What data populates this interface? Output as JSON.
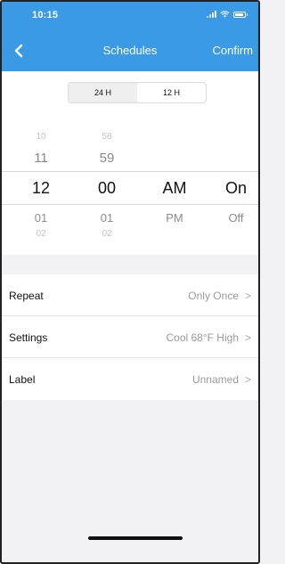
{
  "status_bar": {
    "time": "10:15"
  },
  "nav": {
    "title": "Schedules",
    "confirm_label": "Confirm"
  },
  "segmented": {
    "options": [
      "24 H",
      "12 H"
    ],
    "selected": "12 H"
  },
  "picker": {
    "hour": {
      "items": [
        "10",
        "11",
        "12",
        "01",
        "02"
      ]
    },
    "minute": {
      "items": [
        "58",
        "59",
        "00",
        "01",
        "02"
      ]
    },
    "period": {
      "items": [
        "",
        "",
        "AM",
        "PM",
        ""
      ]
    },
    "power": {
      "items": [
        "",
        "",
        "On",
        "Off",
        ""
      ]
    }
  },
  "settings_list": [
    {
      "label": "Repeat",
      "value": "Only Once"
    },
    {
      "label": "Settings",
      "value": "Cool 68°F High"
    },
    {
      "label": "Label",
      "value": "Unnamed"
    }
  ],
  "chevron": ">",
  "colors": {
    "header": "#3b9ae6",
    "background": "#f2f2f4"
  }
}
